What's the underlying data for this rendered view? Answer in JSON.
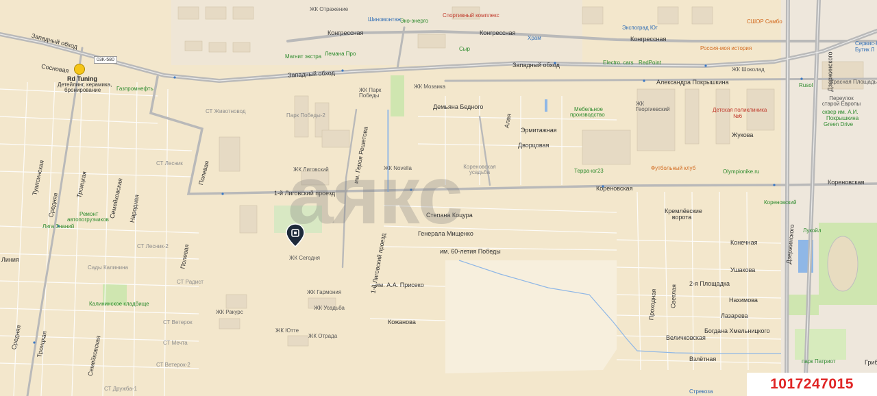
{
  "map": {
    "id_badge": "1017247015",
    "watermark": "аякс",
    "highway_shield": "03К-580",
    "colors": {
      "background": "#f3e7cc",
      "major_road": "#b9b9b9",
      "park": "#cfe6b0",
      "water": "#8fb7e6",
      "id_text": "#e02424"
    },
    "roads": {
      "zapadny_obhod_w": "Западный обход",
      "zapadny_obhod_c": "Западный обход",
      "zapadny_obhod_e": "Западный обход",
      "kongresnaya_1": "Конгрессная",
      "kongresnaya_2": "Конгрессная",
      "kongresnaya_3": "Конгрессная",
      "aleksandra_pokryshkina": "Александра Покрышкина",
      "dzerzhinskogo_1": "Дзержинского",
      "dzerzhinskogo_2": "Дзержинского",
      "korenovskaya_1": "Кореновская",
      "korenovskaya_2": "Кореновская",
      "ligovsky_proezd": "1-й Лиговский проезд",
      "ligovsky_proezd_v": "1-й Лиговский проезд",
      "geroya_reshetova": "им. Героя Решетова",
      "stepana_kotsura": "Степана Коцура",
      "generala_mishchenko": "Генерала Мищенко",
      "pobedy_60": "им. 60-летия Победы",
      "priseko": "им. А.А. Присеко",
      "kozhanova": "Кожанова",
      "demyana_bednogo": "Демьяна Бедного",
      "ermitazhnaya": "Эрмитажная",
      "dvortsovaya": "Дворцовая",
      "alaya": "Алая",
      "konechaya": "Конечная",
      "ushakova": "Ушакова",
      "nakhimova": "Нахимова",
      "lazareva": "Лазарева",
      "bogdana_khmelnitskogo": "Богдана Хмельницкого",
      "velichkovskaya": "Величковская",
      "vzletnaya": "Взлётная",
      "ploshchadka_2": "2-я Площадка",
      "prokhodnaya": "Проходная",
      "svetlaya": "Светлая",
      "zhukova": "Жукова",
      "sosnovaya": "Сосновая",
      "tuapsinskaya": "Туапсинская",
      "srednyaya_1": "Средняя",
      "srednyaya_2": "Средняя",
      "troitskaya_1": "Троицкая",
      "troitskaya_2": "Троицкая",
      "semeynaya_1": "Семейковская",
      "semeynaya_2": "Семейковская",
      "narodnaya": "Народная",
      "polevaya_1": "Полевая",
      "polevaya_2": "Полевая",
      "liniya": "Линия",
      "grib": "Гриб",
      "kremlevskie_vorota": "Кремлёвские ворота"
    },
    "districts": {
      "st_zhivtnovod": "СТ Животновод",
      "st_lesnik": "СТ Лесник",
      "st_lesnik_2": "СТ Лесник-2",
      "sady_kalinina": "Сады Калинина",
      "st_radist": "СТ Радист",
      "st_veterok": "СТ Ветерок",
      "st_mechta": "СТ Мечта",
      "st_veterok_2": "СТ Ветерок-2",
      "st_druzhba": "СТ Дружба-1",
      "park_pobedy_2": "Парк Победы-2",
      "korenovskaya_usadba": "Кореновская усадьба",
      "krasnaya_ploshchad": "Красная Площадь",
      "pereulok_staroy_evropy": "Переулок старой Европы"
    },
    "complexes": {
      "zhk_otrazhenie": "ЖК Отражение",
      "zhk_park_pobedy": "ЖК Парк Победы",
      "zhk_mozaika": "ЖК Мозаика",
      "zhk_ligovsky": "ЖК Лиговский",
      "zhk_novella": "ЖК Novella",
      "zhk_segodnya": "ЖК Сегодня",
      "zhk_garmoniya": "ЖК Гармония",
      "zhk_rakurs": "ЖК Ракурс",
      "zhk_usadba": "ЖК Усадьба",
      "zhk_yutte": "ЖК Ютте",
      "zhk_otrada": "ЖК Отрада",
      "zhk_georgievsky": "ЖК Георгиевский",
      "zhk_shokolad": "ЖК Шоколад"
    },
    "pois": {
      "shinomontazh": "Шиномонтаж",
      "evro_energo": "Эко-энерго",
      "sportivny_kompleks": "Спортивный комплекс",
      "hram": "Храм",
      "ekspograd": "Экспоград Юг",
      "sshor": "СШОР Самбо",
      "magnit": "Магнит экстра",
      "lemana": "Лемана Про",
      "syr": "Сыр",
      "electro_cars": "Electro. cars",
      "redpoint": "RedPoint",
      "rossiya_istoriya": "Россия-моя история",
      "servis_lego": "Сервис-Л",
      "servis_lego_2": "Бутик Л",
      "rusol": "Rusol",
      "gazpromneft": "Газпромнефть",
      "rd_tuning": "Rd Tuning",
      "rd_tuning_sub1": "Детейлинг, керамика,",
      "rd_tuning_sub2": "бронирование",
      "mebelnoe_1": "Мебельное",
      "mebelnoe_2": "производство",
      "detskaya_poliklinika_1": "Детская поликлиника",
      "detskaya_poliklinika_2": "№6",
      "skver_1": "сквер им. А.И.",
      "skver_2": "Покрышкина",
      "green_drive": "Green Drive",
      "terra_yug": "Терра-юг23",
      "futbolny_klub": "Футбольный клуб",
      "olympionike": "Olympionike.ru",
      "korenovskiy": "Кореновский",
      "lukoil": "Лукойл",
      "remont_1": "Ремонт",
      "remont_2": "автопогрузчиков",
      "liga_znaniy": "Лига Знаний",
      "kalininskoe": "Калининское кладбище",
      "park_patriot": "парк Патриот",
      "strekoza": "Стрекоза"
    }
  }
}
